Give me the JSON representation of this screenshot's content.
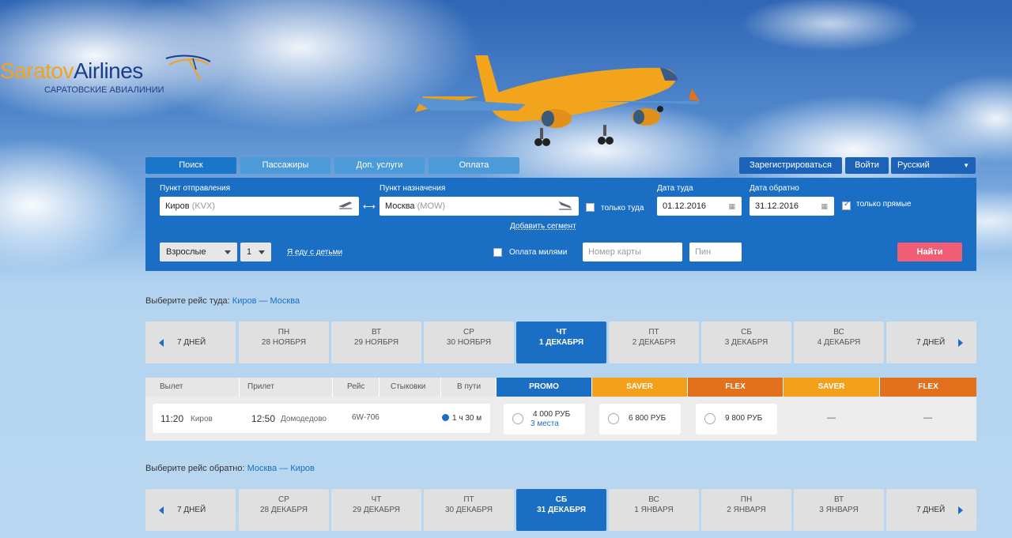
{
  "brand": {
    "name_part1": "Saratov",
    "name_part2": "Airlines",
    "subtitle": "САРАТОВСКИЕ АВИАЛИНИИ",
    "colors": {
      "orange": "#f3a319",
      "navy": "#1b3e8a"
    }
  },
  "tabs": [
    {
      "label": "Поиск",
      "active": true
    },
    {
      "label": "Пассажиры",
      "active": false
    },
    {
      "label": "Доп. услуги",
      "active": false
    },
    {
      "label": "Оплата",
      "active": false
    }
  ],
  "account": {
    "register_label": "Зарегистрироваться",
    "login_label": "Войти",
    "language": "Русский"
  },
  "search": {
    "origin_label": "Пункт отправления",
    "origin_city": "Киров",
    "origin_code": "(KVX)",
    "destination_label": "Пункт назначения",
    "destination_city": "Москва",
    "destination_code": "(MOW)",
    "one_way_label": "только туда",
    "one_way_checked": false,
    "depart_label": "Дата туда",
    "depart_date": "01.12.2016",
    "return_label": "Дата обратно",
    "return_date": "31.12.2016",
    "direct_label": "только прямые",
    "direct_checked": true,
    "add_segment_label": "Добавить сегмент",
    "pax_type": "Взрослые",
    "pax_count": "1",
    "with_children_label": "Я еду с детьми",
    "pay_miles_label": "Оплата милями",
    "pay_miles_checked": false,
    "card_placeholder": "Номер карты",
    "pin_placeholder": "Пин",
    "find_label": "Найти",
    "find_color": "#f05d74",
    "panel_color": "#1a6ec3"
  },
  "outbound": {
    "title_prefix": "Выберите рейс туда:",
    "route": "Киров — Москва",
    "prev_label": "7 ДНЕЙ",
    "next_label": "7 ДНЕЙ",
    "days": [
      {
        "weekday": "ПН",
        "date": "28 НОЯБРЯ",
        "selected": false
      },
      {
        "weekday": "ВТ",
        "date": "29 НОЯБРЯ",
        "selected": false
      },
      {
        "weekday": "СР",
        "date": "30 НОЯБРЯ",
        "selected": false
      },
      {
        "weekday": "ЧТ",
        "date": "1 ДЕКАБРЯ",
        "selected": true
      },
      {
        "weekday": "ПТ",
        "date": "2 ДЕКАБРЯ",
        "selected": false
      },
      {
        "weekday": "СБ",
        "date": "3 ДЕКАБРЯ",
        "selected": false
      },
      {
        "weekday": "ВС",
        "date": "4 ДЕКАБРЯ",
        "selected": false
      }
    ]
  },
  "flights": {
    "headers": {
      "depart": "Вылет",
      "arrive": "Прилет",
      "flight": "Рейс",
      "connections": "Стыковки",
      "duration": "В пути"
    },
    "fare_headers": [
      {
        "label": "PROMO",
        "color": "#1a6ec3"
      },
      {
        "label": "SAVER",
        "color": "#f5a01a"
      },
      {
        "label": "FLEX",
        "color": "#e2701c"
      },
      {
        "label": "SAVER",
        "color": "#f5a01a"
      },
      {
        "label": "FLEX",
        "color": "#e2701c"
      }
    ],
    "row": {
      "dep_time": "11:20",
      "dep_city": "Киров",
      "arr_time": "12:50",
      "arr_airport": "Домодедово",
      "flight_no": "6W-706",
      "duration": "1 ч 30 м",
      "fares": [
        {
          "price": "4 000 РУБ",
          "note": "3 места"
        },
        {
          "price": "6 800 РУБ",
          "note": ""
        },
        {
          "price": "9 800 РУБ",
          "note": ""
        }
      ],
      "unavailable": [
        "—",
        "—"
      ]
    }
  },
  "inbound": {
    "title_prefix": "Выберите рейс обратно:",
    "route": "Москва — Киров",
    "prev_label": "7 ДНЕЙ",
    "next_label": "7 ДНЕЙ",
    "days": [
      {
        "weekday": "СР",
        "date": "28 ДЕКАБРЯ",
        "selected": false
      },
      {
        "weekday": "ЧТ",
        "date": "29 ДЕКАБРЯ",
        "selected": false
      },
      {
        "weekday": "ПТ",
        "date": "30 ДЕКАБРЯ",
        "selected": false
      },
      {
        "weekday": "СБ",
        "date": "31 ДЕКАБРЯ",
        "selected": true
      },
      {
        "weekday": "ВС",
        "date": "1 ЯНВАРЯ",
        "selected": false
      },
      {
        "weekday": "ПН",
        "date": "2 ЯНВАРЯ",
        "selected": false
      },
      {
        "weekday": "ВТ",
        "date": "3 ЯНВАРЯ",
        "selected": false
      }
    ]
  }
}
